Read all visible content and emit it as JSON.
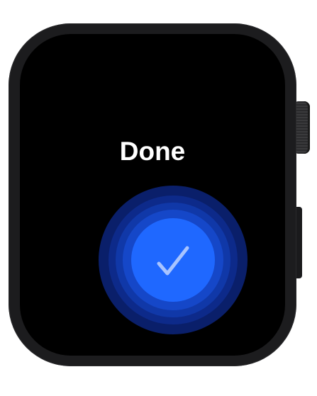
{
  "screen": {
    "title": "Done",
    "confirm": {
      "icon": "checkmark-icon",
      "colors": {
        "core": "#1f68ff",
        "rings": [
          "#1547c8",
          "#1038a8",
          "#0d2a8a",
          "#0a1f6a"
        ],
        "check": "#a8c4ff"
      }
    }
  },
  "device": {
    "case_color": "#1c1c1e",
    "screen_color": "#000000"
  }
}
